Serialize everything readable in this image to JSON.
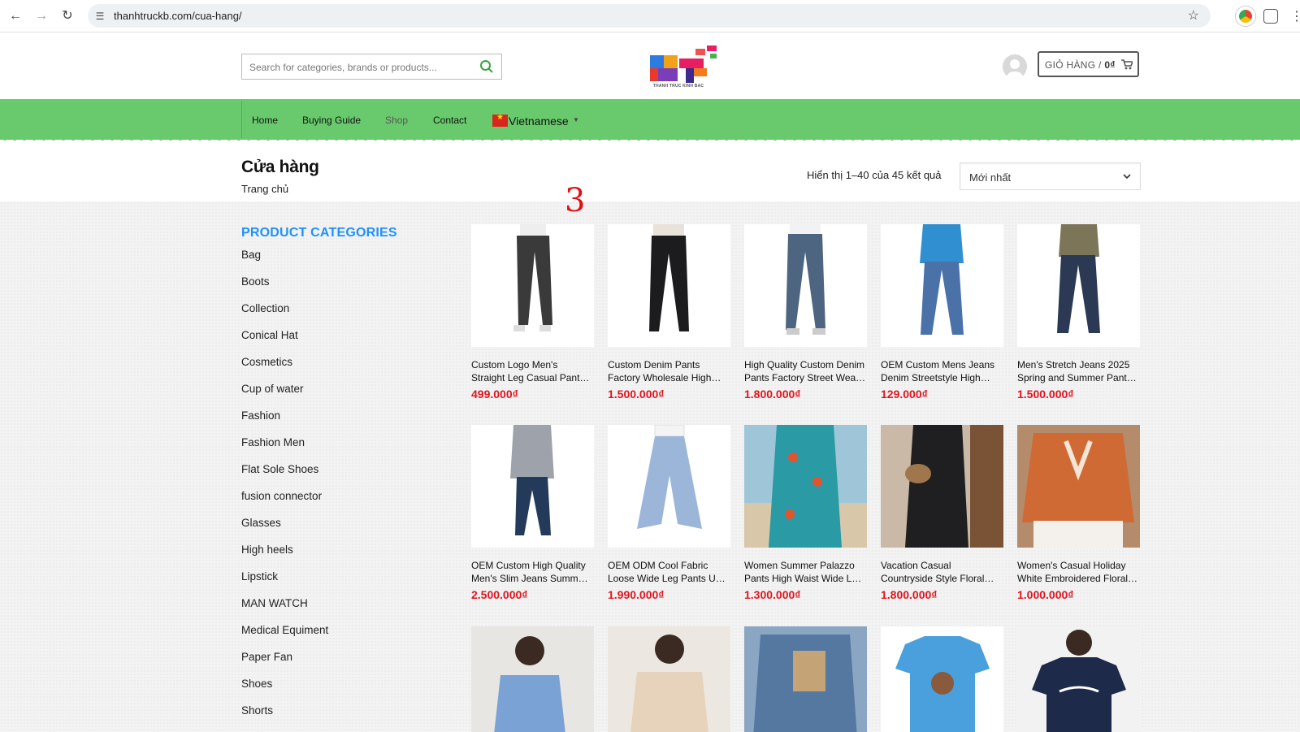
{
  "browser": {
    "url": "thanhtruckb.com/cua-hang/"
  },
  "header": {
    "search_placeholder": "Search for categories, brands or products...",
    "logo_text": "THANH TRUC KINH BAC",
    "cart_label": "GIỎ HÀNG /",
    "cart_total": "0₫"
  },
  "nav": {
    "items": [
      "Home",
      "Buying Guide",
      "Shop",
      "Contact"
    ],
    "language": "Vietnamese"
  },
  "page": {
    "title": "Cửa hàng",
    "breadcrumb": "Trang chủ",
    "result_count": "Hiển thị 1–40 của 45 kết quả",
    "orderby": "Mới nhất",
    "annotation": "3"
  },
  "sidebar": {
    "title": "PRODUCT CATEGORIES",
    "categories": [
      "Bag",
      "Boots",
      "Collection",
      "Conical Hat",
      "Cosmetics",
      "Cup of water",
      "Fashion",
      "Fashion Men",
      "Flat Sole Shoes",
      "fusion connector",
      "Glasses",
      "High heels",
      "Lipstick",
      "MAN WATCH",
      "Medical Equiment",
      "Paper Fan",
      "Shoes",
      "Shorts"
    ]
  },
  "products": [
    {
      "line1": "Custom Logo Men's",
      "line2": "Straight Leg Casual Pant…",
      "price": "499.000₫"
    },
    {
      "line1": "Custom Denim Pants",
      "line2": "Factory Wholesale High…",
      "price": "1.500.000₫"
    },
    {
      "line1": "High Quality Custom Denim",
      "line2": "Pants Factory Street Wea…",
      "price": "1.800.000₫"
    },
    {
      "line1": "OEM Custom Mens Jeans",
      "line2": "Denim Streetstyle High…",
      "price": "129.000₫"
    },
    {
      "line1": "Men's Stretch Jeans 2025",
      "line2": "Spring and Summer Pant…",
      "price": "1.500.000₫"
    },
    {
      "line1": "OEM Custom High Quality",
      "line2": "Men's Slim Jeans Summ…",
      "price": "2.500.000₫"
    },
    {
      "line1": "OEM ODM Cool Fabric",
      "line2": "Loose Wide Leg Pants U…",
      "price": "1.990.000₫"
    },
    {
      "line1": "Women Summer Palazzo",
      "line2": "Pants High Waist Wide L…",
      "price": "1.300.000₫"
    },
    {
      "line1": "Vacation Casual",
      "line2": "Countryside Style Floral…",
      "price": "1.800.000₫"
    },
    {
      "line1": "Women's Casual Holiday",
      "line2": "White Embroidered Floral…",
      "price": "1.000.000₫"
    },
    {
      "line1": "",
      "line2": "",
      "price": ""
    },
    {
      "line1": "",
      "line2": "",
      "price": ""
    },
    {
      "line1": "",
      "line2": "",
      "price": ""
    },
    {
      "line1": "",
      "line2": "",
      "price": ""
    },
    {
      "line1": "",
      "line2": "",
      "price": ""
    }
  ],
  "colors": {
    "nav_green": "#69ca6d",
    "category_title": "#1e90ff",
    "price_red": "#e0141e"
  }
}
